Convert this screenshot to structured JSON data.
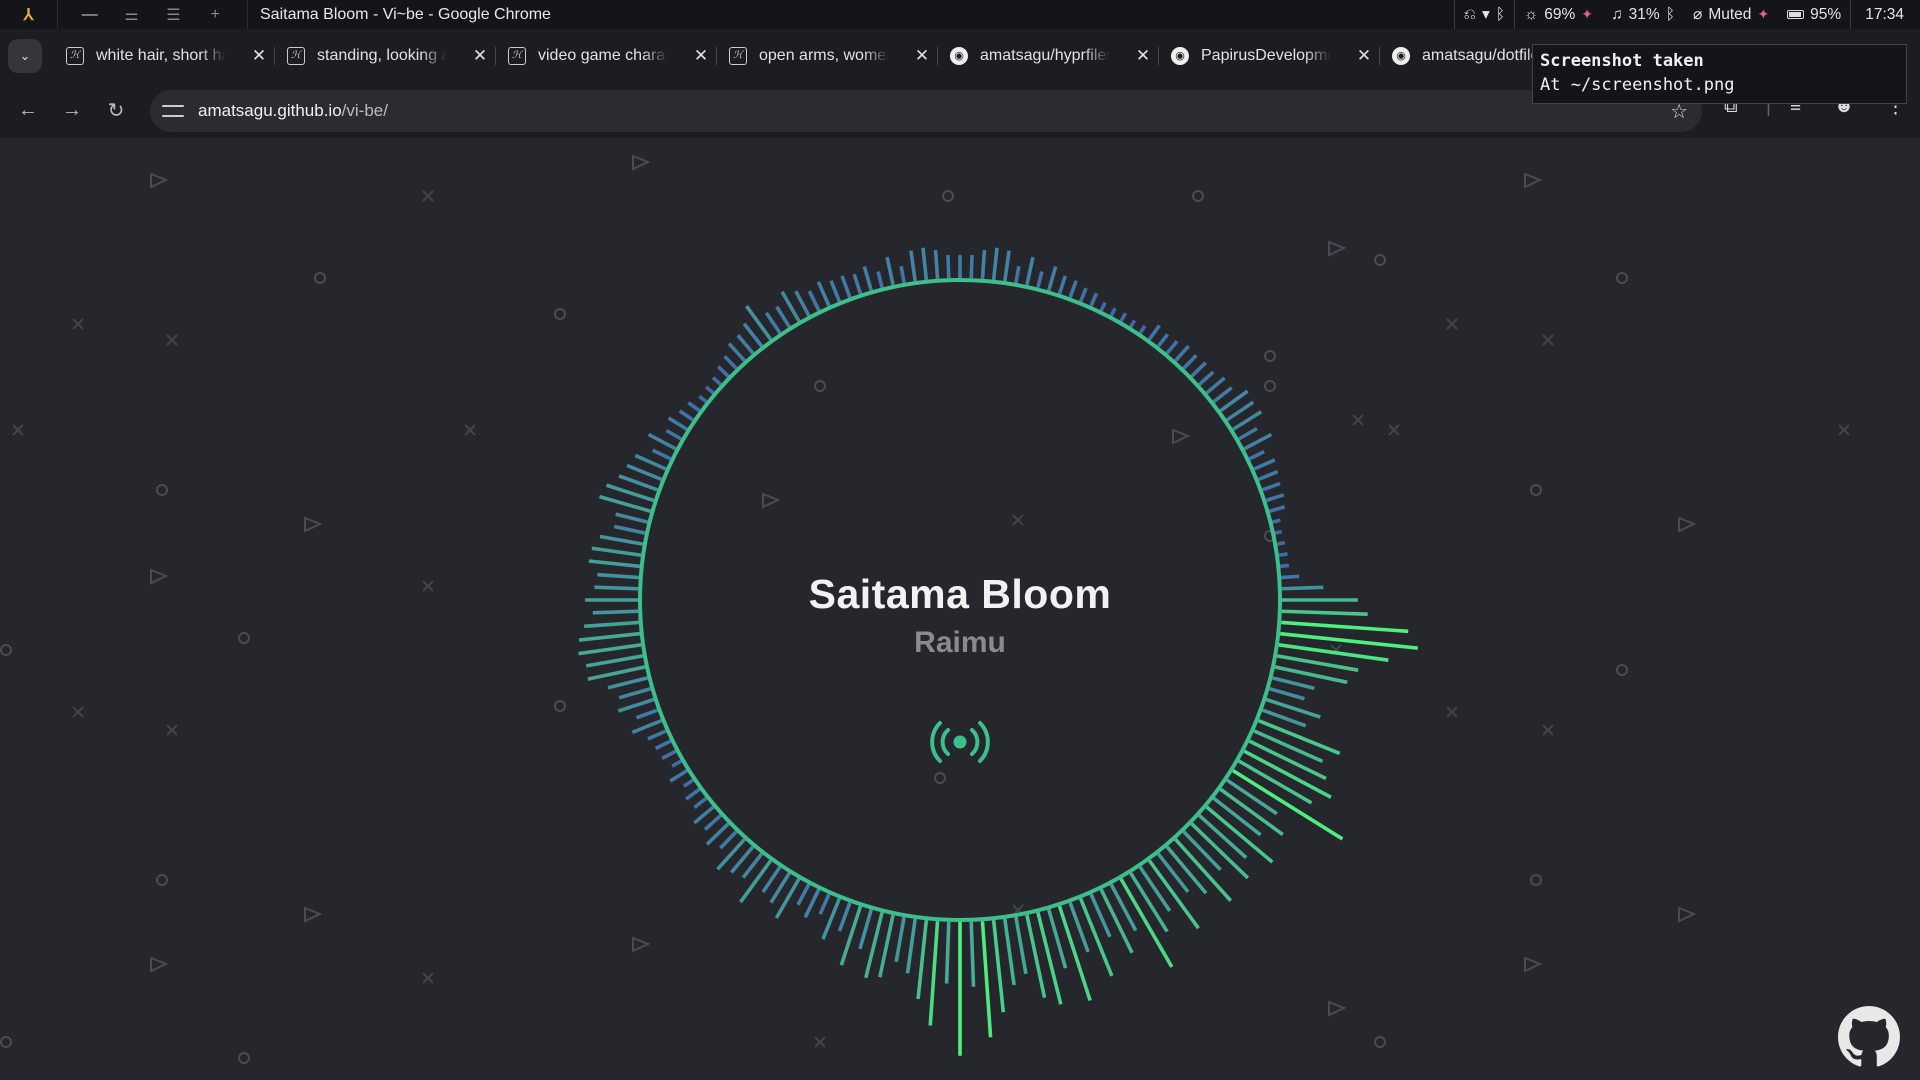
{
  "system_bar": {
    "window_title": "Saitama Bloom - Vi~be - Google Chrome",
    "brightness": "69%",
    "volume": "31%",
    "mic_status": "Muted",
    "battery": "95%",
    "clock": "17:34"
  },
  "tabs": [
    {
      "label": "white hair, short hair",
      "favicon": "site-favicon-icon"
    },
    {
      "label": "standing, looking at",
      "favicon": "site-favicon-icon"
    },
    {
      "label": "video game character",
      "favicon": "site-favicon-icon"
    },
    {
      "label": "open arms, women",
      "favicon": "site-favicon-icon"
    },
    {
      "label": "amatsagu/hyprfiles",
      "favicon": "github-icon"
    },
    {
      "label": "PapirusDevelopment",
      "favicon": "github-icon"
    },
    {
      "label": "amatsagu/dotfiles",
      "favicon": "github-icon"
    }
  ],
  "address_bar": {
    "host": "amatsagu.github.io",
    "path": "/vi-be/"
  },
  "player": {
    "song_title": "Saitama Bloom",
    "artist": "Raimu"
  },
  "notification": {
    "title": "Screenshot taken",
    "body": "At ~/screenshot.png"
  },
  "colors": {
    "page_background": "#26272c",
    "ring": "#3dbf8c",
    "bar_low": "#3f5fae",
    "bar_high": "#4cf07e",
    "title_text": "#f2f2f2",
    "artist_text": "#8b8b8f"
  }
}
